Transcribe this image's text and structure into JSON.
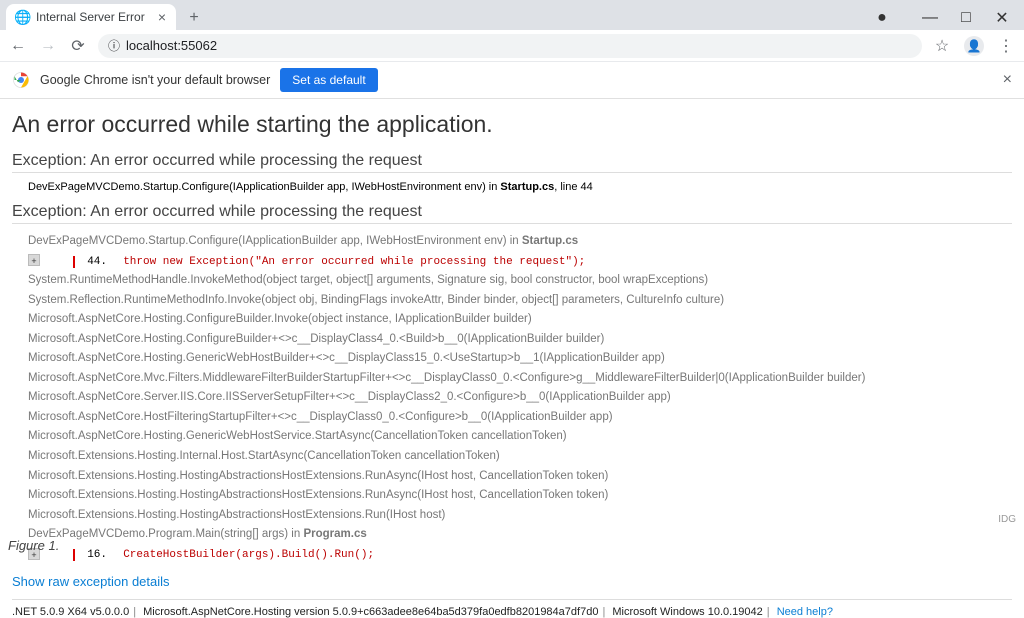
{
  "browser": {
    "tab_title": "Internal Server Error",
    "url": "localhost:55062",
    "infobar_text": "Google Chrome isn't your default browser",
    "infobar_button": "Set as default"
  },
  "page": {
    "title": "An error occurred while starting the application.",
    "summary_heading": "Exception: An error occurred while processing the request",
    "summary_line_pre": "DevExPageMVCDemo.Startup.Configure(IApplicationBuilder app, IWebHostEnvironment env) in ",
    "summary_file": "Startup.cs",
    "summary_line_suf": ", line 44",
    "detail_heading": "Exception: An error occurred while processing the request",
    "frame0": {
      "pre": "DevExPageMVCDemo.Startup.Configure(IApplicationBuilder app, IWebHostEnvironment env) in ",
      "file": "Startup.cs",
      "line": "44.",
      "code": "throw new Exception(\"An error occurred while processing the request\");"
    },
    "frames_mid": [
      "System.RuntimeMethodHandle.InvokeMethod(object target, object[] arguments, Signature sig, bool constructor, bool wrapExceptions)",
      "System.Reflection.RuntimeMethodInfo.Invoke(object obj, BindingFlags invokeAttr, Binder binder, object[] parameters, CultureInfo culture)",
      "Microsoft.AspNetCore.Hosting.ConfigureBuilder.Invoke(object instance, IApplicationBuilder builder)",
      "Microsoft.AspNetCore.Hosting.ConfigureBuilder+<>c__DisplayClass4_0.<Build>b__0(IApplicationBuilder builder)",
      "Microsoft.AspNetCore.Hosting.GenericWebHostBuilder+<>c__DisplayClass15_0.<UseStartup>b__1(IApplicationBuilder app)",
      "Microsoft.AspNetCore.Mvc.Filters.MiddlewareFilterBuilderStartupFilter+<>c__DisplayClass0_0.<Configure>g__MiddlewareFilterBuilder|0(IApplicationBuilder builder)",
      "Microsoft.AspNetCore.Server.IIS.Core.IISServerSetupFilter+<>c__DisplayClass2_0.<Configure>b__0(IApplicationBuilder app)",
      "Microsoft.AspNetCore.HostFilteringStartupFilter+<>c__DisplayClass0_0.<Configure>b__0(IApplicationBuilder app)",
      "Microsoft.AspNetCore.Hosting.GenericWebHostService.StartAsync(CancellationToken cancellationToken)",
      "Microsoft.Extensions.Hosting.Internal.Host.StartAsync(CancellationToken cancellationToken)",
      "Microsoft.Extensions.Hosting.HostingAbstractionsHostExtensions.RunAsync(IHost host, CancellationToken token)",
      "Microsoft.Extensions.Hosting.HostingAbstractionsHostExtensions.RunAsync(IHost host, CancellationToken token)",
      "Microsoft.Extensions.Hosting.HostingAbstractionsHostExtensions.Run(IHost host)"
    ],
    "frameN": {
      "pre": "DevExPageMVCDemo.Program.Main(string[] args) in ",
      "file": "Program.cs",
      "line": "16.",
      "code": "CreateHostBuilder(args).Build().Run();"
    },
    "raw_link": "Show raw exception details",
    "footer_runtime": ".NET 5.0.9 X64 v5.0.0.0",
    "footer_hosting": "Microsoft.AspNetCore.Hosting version 5.0.9+c663adee8e64ba5d379fa0edfb8201984a7df7d0",
    "footer_os": "Microsoft Windows 10.0.19042",
    "footer_help": "Need help?"
  },
  "figure_label": "Figure 1.",
  "watermark": "IDG"
}
